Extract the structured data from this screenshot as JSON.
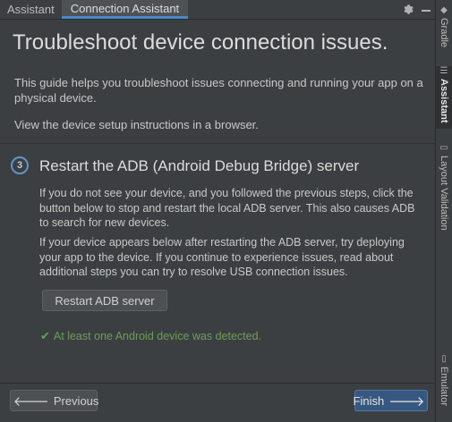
{
  "tabs": [
    {
      "label": "Assistant",
      "active": false
    },
    {
      "label": "Connection Assistant",
      "active": true
    }
  ],
  "toolbar_icons": [
    "gear-icon",
    "minimize-icon"
  ],
  "right_stripe": [
    {
      "label": "Gradle",
      "icon": "elephant-icon",
      "active": false
    },
    {
      "label": "Assistant",
      "icon": "list-icon",
      "active": true
    },
    {
      "label": "Layout Validation",
      "icon": "layout-icon",
      "active": false
    },
    {
      "label": "Emulator",
      "icon": "device-icon",
      "active": false
    }
  ],
  "page": {
    "title": "Troubleshoot device connection issues.",
    "intro": "This guide helps you troubleshoot issues connecting and running your app on a physical device.",
    "browser_link": "View the device setup instructions in a browser."
  },
  "step": {
    "number": "3",
    "title": "Restart the ADB (Android Debug Bridge) server",
    "para1": "If you do not see your device, and you followed the previous steps, click the button below to stop and restart the local ADB server. This also causes ADB to search for new devices.",
    "para2": "If your device appears below after restarting the ADB server, try deploying your app to the device. If you continue to experience issues, read about additional steps you can try to resolve USB connection issues.",
    "button_label": "Restart ADB server",
    "status": "At least one Android device was detected."
  },
  "footer": {
    "previous_label": "Previous",
    "finish_label": "Finish"
  },
  "colors": {
    "background": "#3c3f41",
    "accent": "#4a88c7",
    "success": "#6a9e5a",
    "primary_button": "#365880"
  }
}
